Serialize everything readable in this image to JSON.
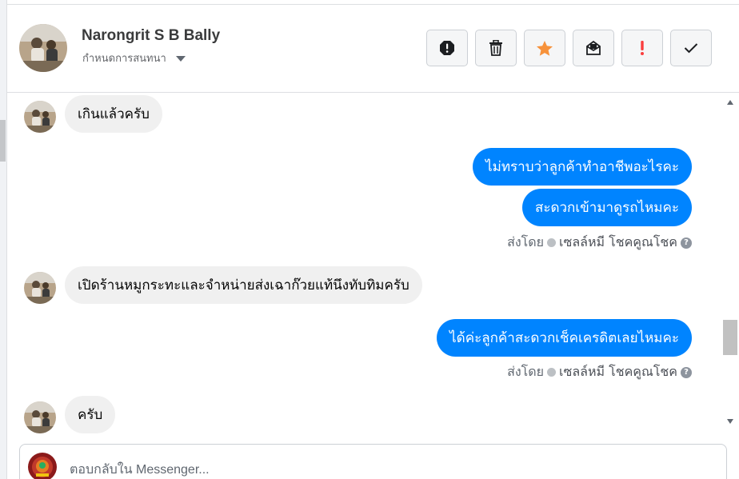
{
  "header": {
    "contact_name": "Narongrit S B Bally",
    "assign_label": "กำหนดการสนทนา",
    "actions": [
      {
        "name": "spam",
        "icon": "alert-octagon-icon"
      },
      {
        "name": "delete",
        "icon": "trash-icon"
      },
      {
        "name": "star",
        "icon": "star-icon",
        "color": "#f7923b"
      },
      {
        "name": "mark-unread",
        "icon": "envelope-icon"
      },
      {
        "name": "important",
        "icon": "exclamation-icon",
        "color": "#fa3e3e"
      },
      {
        "name": "done",
        "icon": "check-icon"
      }
    ]
  },
  "messages": [
    {
      "from": "customer",
      "text": "เกินแล้วครับ"
    },
    {
      "from": "page",
      "text": "ไม่ทราบว่าลูกค้าทำอาชีพอะไรคะ"
    },
    {
      "from": "page",
      "text": "สะดวกเข้ามาดูรถไหมคะ"
    },
    {
      "sent_by_label": "ส่งโดย",
      "agent": "เซลล์หมี โชคคูณโชค",
      "help": "?"
    },
    {
      "from": "customer",
      "text": "เปิดร้านหมูกระทะและจำหน่ายส่งเฉาก๊วยแท้นึงทับทิมครับ"
    },
    {
      "from": "page",
      "text": "ได้ค่ะลูกค้าสะดวกเช็คเครดิตเลยไหมคะ"
    },
    {
      "sent_by_label": "ส่งโดย",
      "agent": "เซลล์หมี โชคคูณโชค",
      "help": "?"
    },
    {
      "from": "customer",
      "text": "ครับ"
    }
  ],
  "composer": {
    "placeholder": "ตอบกลับใน Messenger..."
  },
  "colors": {
    "outgoing_bubble": "#0084ff",
    "incoming_bubble": "#f0f0f0"
  }
}
